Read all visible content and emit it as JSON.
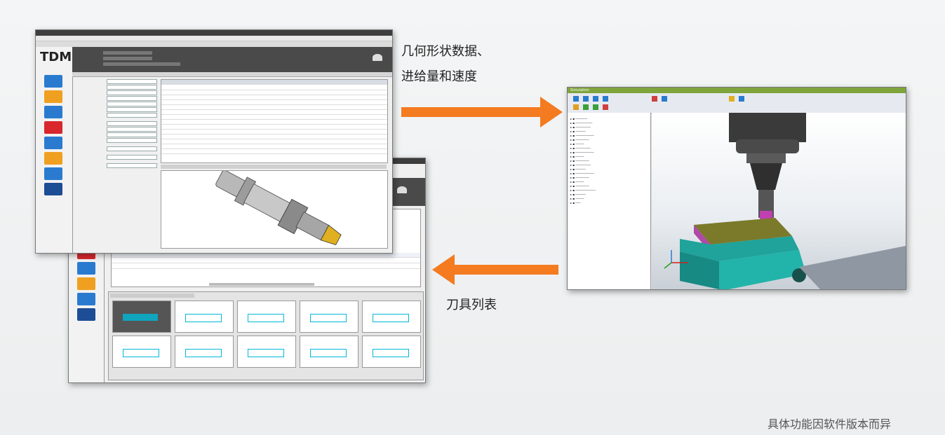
{
  "annotations": {
    "top_caption_line1": "几何形状数据、",
    "top_caption_line2": "进给量和速度",
    "bottom_caption": "刀具列表",
    "footnote": "具体功能因软件版本而异"
  },
  "tdm_window": {
    "logo": "TDM",
    "icon_colors": {
      "blue": "#2a7bd0",
      "orange": "#f0a020",
      "red": "#d8272d",
      "navy": "#1d4d94"
    }
  },
  "sim_window": {
    "tab_label": "Simulation"
  },
  "colors": {
    "arrow": "#f47b20",
    "dark_header": "#4a4a4a",
    "cad_cyan": "#00b8d8",
    "vise_teal": "#1fa39b",
    "workpiece_olive": "#7a7a2a",
    "tool_magenta": "#c040b0"
  }
}
